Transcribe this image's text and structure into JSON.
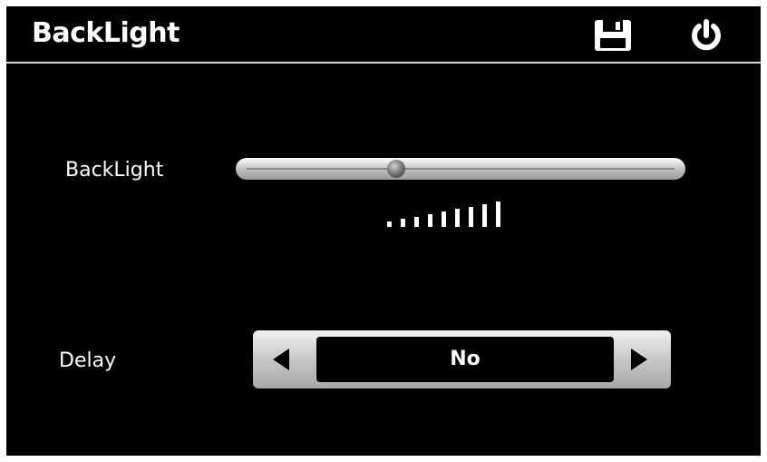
{
  "header": {
    "title": "BackLight",
    "save_icon": "floppy-disk-icon",
    "power_icon": "power-icon"
  },
  "backlight": {
    "label": "BackLight",
    "level_fraction": 0.35,
    "level_bars_total": 9
  },
  "delay": {
    "label": "Delay",
    "value": "No",
    "prev_icon": "triangle-left-icon",
    "next_icon": "triangle-right-icon"
  },
  "colors": {
    "background": "#000000",
    "text": "#ffffff",
    "control_gray": "#c8c8c8"
  }
}
